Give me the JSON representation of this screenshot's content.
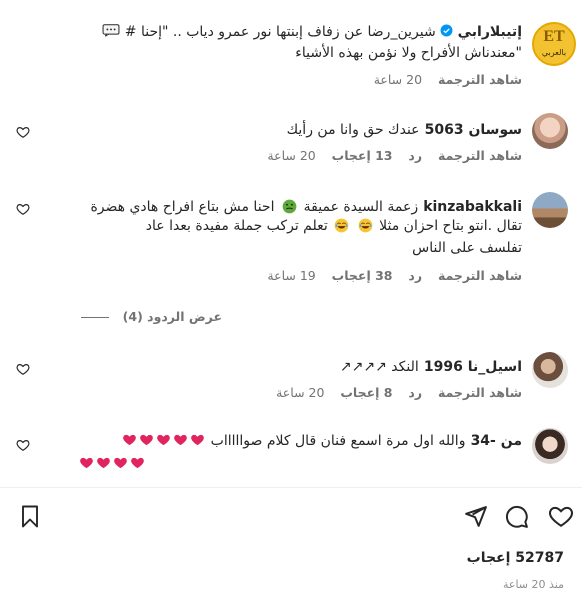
{
  "caption": {
    "author": "إتيبلارابي",
    "line1": "شيرين_رضا عن زفاف إبنتها نور عمرو دياب .. \"إحنا # ",
    "line2": "\"معندناش الأفراح ولا نؤمن بهذه الأشياء",
    "translate": "شاهد الترجمة",
    "time": "20 ساعة",
    "logo_text": "ET",
    "logo_sub": "بالعربي"
  },
  "comments": [
    {
      "username": "سوسان 5063",
      "text": "عندك حق وانا من رأيك",
      "translate": "شاهد الترجمة",
      "reply": "رد",
      "likes": "13 إعجاب",
      "time": "20 ساعة"
    },
    {
      "username": "kinzabakkali",
      "line1": "زعمة السيدة عميقة",
      "line1b": "احنا مش بتاع افراح هادي هضرة",
      "line2a": "تقال .انتو بتاح احزان مثلا",
      "line2b": "تعلم تركب جملة مفيدة بعدا عاد",
      "line3": "تفلسف على الناس",
      "translate": "شاهد الترجمة",
      "reply": "رد",
      "likes": "38 إعجاب",
      "time": "19 ساعة",
      "view_replies": "عرض الردود (4)"
    },
    {
      "username": "اسيل_نا 1996",
      "text": "النكد ↗↗↗↗",
      "translate": "شاهد الترجمة",
      "reply": "رد",
      "likes": "8 إعجاب",
      "time": "20 ساعة"
    },
    {
      "username": "من -34",
      "text": "والله اول مرة اسمع فنان قال كلام صواااااب"
    }
  ],
  "footer": {
    "likes": "52787 إعجاب",
    "time": "منذ 20 ساعة"
  },
  "colors": {
    "heart_red": "#e0245e",
    "verified_blue": "#0095f6",
    "logo_gold": "#f2c230"
  }
}
